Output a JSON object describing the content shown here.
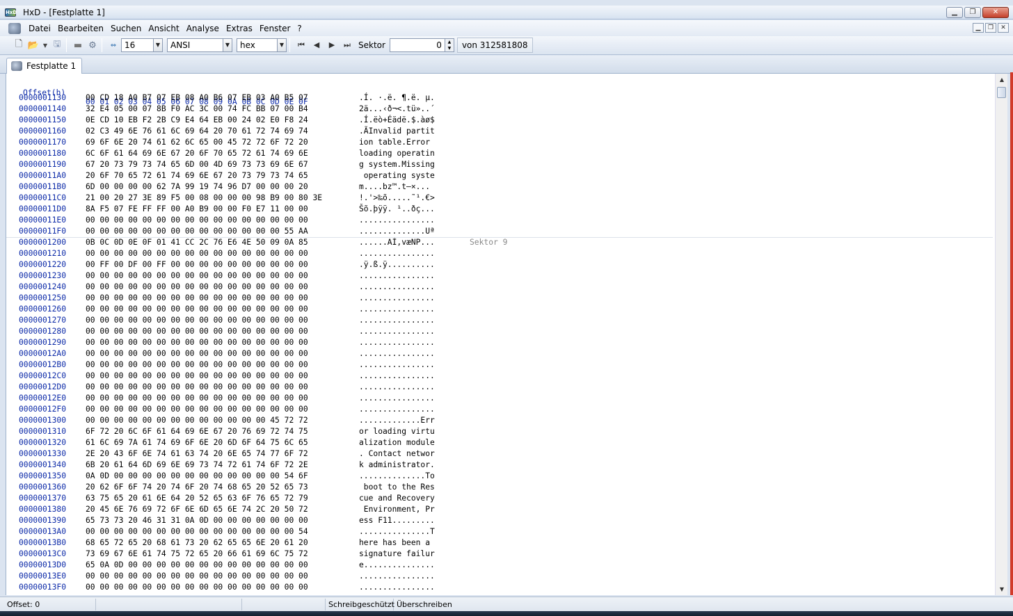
{
  "window": {
    "title": "HxD - [Festplatte 1]"
  },
  "menu": [
    "Datei",
    "Bearbeiten",
    "Suchen",
    "Ansicht",
    "Analyse",
    "Extras",
    "Fenster",
    "?"
  ],
  "toolbar": {
    "bytes_per_row": "16",
    "charset": "ANSI",
    "offset_base": "hex",
    "sector_label": "Sektor",
    "sector_value": "0",
    "sector_total": "von 312581808"
  },
  "tab": {
    "label": "Festplatte 1"
  },
  "hex_header": {
    "offset_label": "Offset(h)",
    "columns": "00 01 02 03 04 05 06 07 08 09 0A 0B 0C 0D 0E 0F"
  },
  "sector_marker_row": 13,
  "rows": [
    {
      "off": "0000001130",
      "hex": "00 CD 18 A0 B7 07 EB 08 A0 B6 07 EB 03 A0 B5 07",
      "txt": ".Í. ·.ë. ¶.ë. µ."
    },
    {
      "off": "0000001140",
      "hex": "32 E4 05 00 07 8B F0 AC 3C 00 74 FC BB 07 00 B4",
      "txt": "2ä...‹ð¬<.tü»..´"
    },
    {
      "off": "0000001150",
      "hex": "0E CD 10 EB F2 2B C9 E4 64 EB 00 24 02 E0 F8 24",
      "txt": ".Í.ëò+Éädë.$.àø$"
    },
    {
      "off": "0000001160",
      "hex": "02 C3 49 6E 76 61 6C 69 64 20 70 61 72 74 69 74",
      "txt": ".ÃInvalid partit"
    },
    {
      "off": "0000001170",
      "hex": "69 6F 6E 20 74 61 62 6C 65 00 45 72 72 6F 72 20",
      "txt": "ion table.Error "
    },
    {
      "off": "0000001180",
      "hex": "6C 6F 61 64 69 6E 67 20 6F 70 65 72 61 74 69 6E",
      "txt": "loading operatin"
    },
    {
      "off": "0000001190",
      "hex": "67 20 73 79 73 74 65 6D 00 4D 69 73 73 69 6E 67",
      "txt": "g system.Missing"
    },
    {
      "off": "00000011A0",
      "hex": "20 6F 70 65 72 61 74 69 6E 67 20 73 79 73 74 65",
      "txt": " operating syste"
    },
    {
      "off": "00000011B0",
      "hex": "6D 00 00 00 00 62 7A 99 19 74 96 D7 00 00 00 20",
      "txt": "m....bz™.t–×... "
    },
    {
      "off": "00000011C0",
      "hex": "21 00 20 27 3E 89 F5 00 08 00 00 00 98 B9 00 80 3E",
      "txt": "!.'>‰õ.....˜¹.€>"
    },
    {
      "off": "00000011D0",
      "hex": "8A F5 07 FE FF FF 00 A0 B9 00 00 F0 E7 11 00 00",
      "txt": "Šõ.þÿÿ. ¹..ðç..."
    },
    {
      "off": "00000011E0",
      "hex": "00 00 00 00 00 00 00 00 00 00 00 00 00 00 00 00",
      "txt": "................"
    },
    {
      "off": "00000011F0",
      "hex": "00 00 00 00 00 00 00 00 00 00 00 00 00 00 55 AA",
      "txt": "..............Uª"
    },
    {
      "off": "0000001200",
      "hex": "0B 0C 0D 0E 0F 01 41 CC 2C 76 E6 4E 50 09 0A 85",
      "txt": "......AÌ,væNP...",
      "sect": "Sektor 9"
    },
    {
      "off": "0000001210",
      "hex": "00 00 00 00 00 00 00 00 00 00 00 00 00 00 00 00",
      "txt": "................"
    },
    {
      "off": "0000001220",
      "hex": "00 FF 00 DF 00 FF 00 00 00 00 00 00 00 00 00 00",
      "txt": ".ÿ.ß.ÿ.........."
    },
    {
      "off": "0000001230",
      "hex": "00 00 00 00 00 00 00 00 00 00 00 00 00 00 00 00",
      "txt": "................"
    },
    {
      "off": "0000001240",
      "hex": "00 00 00 00 00 00 00 00 00 00 00 00 00 00 00 00",
      "txt": "................"
    },
    {
      "off": "0000001250",
      "hex": "00 00 00 00 00 00 00 00 00 00 00 00 00 00 00 00",
      "txt": "................"
    },
    {
      "off": "0000001260",
      "hex": "00 00 00 00 00 00 00 00 00 00 00 00 00 00 00 00",
      "txt": "................"
    },
    {
      "off": "0000001270",
      "hex": "00 00 00 00 00 00 00 00 00 00 00 00 00 00 00 00",
      "txt": "................"
    },
    {
      "off": "0000001280",
      "hex": "00 00 00 00 00 00 00 00 00 00 00 00 00 00 00 00",
      "txt": "................"
    },
    {
      "off": "0000001290",
      "hex": "00 00 00 00 00 00 00 00 00 00 00 00 00 00 00 00",
      "txt": "................"
    },
    {
      "off": "00000012A0",
      "hex": "00 00 00 00 00 00 00 00 00 00 00 00 00 00 00 00",
      "txt": "................"
    },
    {
      "off": "00000012B0",
      "hex": "00 00 00 00 00 00 00 00 00 00 00 00 00 00 00 00",
      "txt": "................"
    },
    {
      "off": "00000012C0",
      "hex": "00 00 00 00 00 00 00 00 00 00 00 00 00 00 00 00",
      "txt": "................"
    },
    {
      "off": "00000012D0",
      "hex": "00 00 00 00 00 00 00 00 00 00 00 00 00 00 00 00",
      "txt": "................"
    },
    {
      "off": "00000012E0",
      "hex": "00 00 00 00 00 00 00 00 00 00 00 00 00 00 00 00",
      "txt": "................"
    },
    {
      "off": "00000012F0",
      "hex": "00 00 00 00 00 00 00 00 00 00 00 00 00 00 00 00",
      "txt": "................"
    },
    {
      "off": "0000001300",
      "hex": "00 00 00 00 00 00 00 00 00 00 00 00 00 45 72 72",
      "txt": ".............Err"
    },
    {
      "off": "0000001310",
      "hex": "6F 72 20 6C 6F 61 64 69 6E 67 20 76 69 72 74 75",
      "txt": "or loading virtu"
    },
    {
      "off": "0000001320",
      "hex": "61 6C 69 7A 61 74 69 6F 6E 20 6D 6F 64 75 6C 65",
      "txt": "alization module"
    },
    {
      "off": "0000001330",
      "hex": "2E 20 43 6F 6E 74 61 63 74 20 6E 65 74 77 6F 72",
      "txt": ". Contact networ"
    },
    {
      "off": "0000001340",
      "hex": "6B 20 61 64 6D 69 6E 69 73 74 72 61 74 6F 72 2E",
      "txt": "k administrator."
    },
    {
      "off": "0000001350",
      "hex": "0A 0D 00 00 00 00 00 00 00 00 00 00 00 00 54 6F",
      "txt": "..............To"
    },
    {
      "off": "0000001360",
      "hex": "20 62 6F 6F 74 20 74 6F 20 74 68 65 20 52 65 73",
      "txt": " boot to the Res"
    },
    {
      "off": "0000001370",
      "hex": "63 75 65 20 61 6E 64 20 52 65 63 6F 76 65 72 79",
      "txt": "cue and Recovery"
    },
    {
      "off": "0000001380",
      "hex": "20 45 6E 76 69 72 6F 6E 6D 65 6E 74 2C 20 50 72",
      "txt": " Environment, Pr"
    },
    {
      "off": "0000001390",
      "hex": "65 73 73 20 46 31 31 0A 0D 00 00 00 00 00 00 00",
      "txt": "ess F11........."
    },
    {
      "off": "00000013A0",
      "hex": "00 00 00 00 00 00 00 00 00 00 00 00 00 00 00 54",
      "txt": "...............T"
    },
    {
      "off": "00000013B0",
      "hex": "68 65 72 65 20 68 61 73 20 62 65 65 6E 20 61 20",
      "txt": "here has been a "
    },
    {
      "off": "00000013C0",
      "hex": "73 69 67 6E 61 74 75 72 65 20 66 61 69 6C 75 72",
      "txt": "signature failur"
    },
    {
      "off": "00000013D0",
      "hex": "65 0A 0D 00 00 00 00 00 00 00 00 00 00 00 00 00",
      "txt": "e..............."
    },
    {
      "off": "00000013E0",
      "hex": "00 00 00 00 00 00 00 00 00 00 00 00 00 00 00 00",
      "txt": "................"
    },
    {
      "off": "00000013F0",
      "hex": "00 00 00 00 00 00 00 00 00 00 00 00 00 00 00 00",
      "txt": "................"
    }
  ],
  "status": {
    "offset": "Offset: 0",
    "readonly": "Schreibgeschützt",
    "mode": "Überschreiben"
  },
  "colors": {
    "offset_blue": "#0c2aa8",
    "accent_red": "#d23a2a"
  },
  "icons": [
    "new-file-icon",
    "open-folder-icon",
    "save-icon",
    "disk-icon",
    "ram-icon",
    "first-icon",
    "prev-icon",
    "next-icon",
    "last-icon"
  ]
}
